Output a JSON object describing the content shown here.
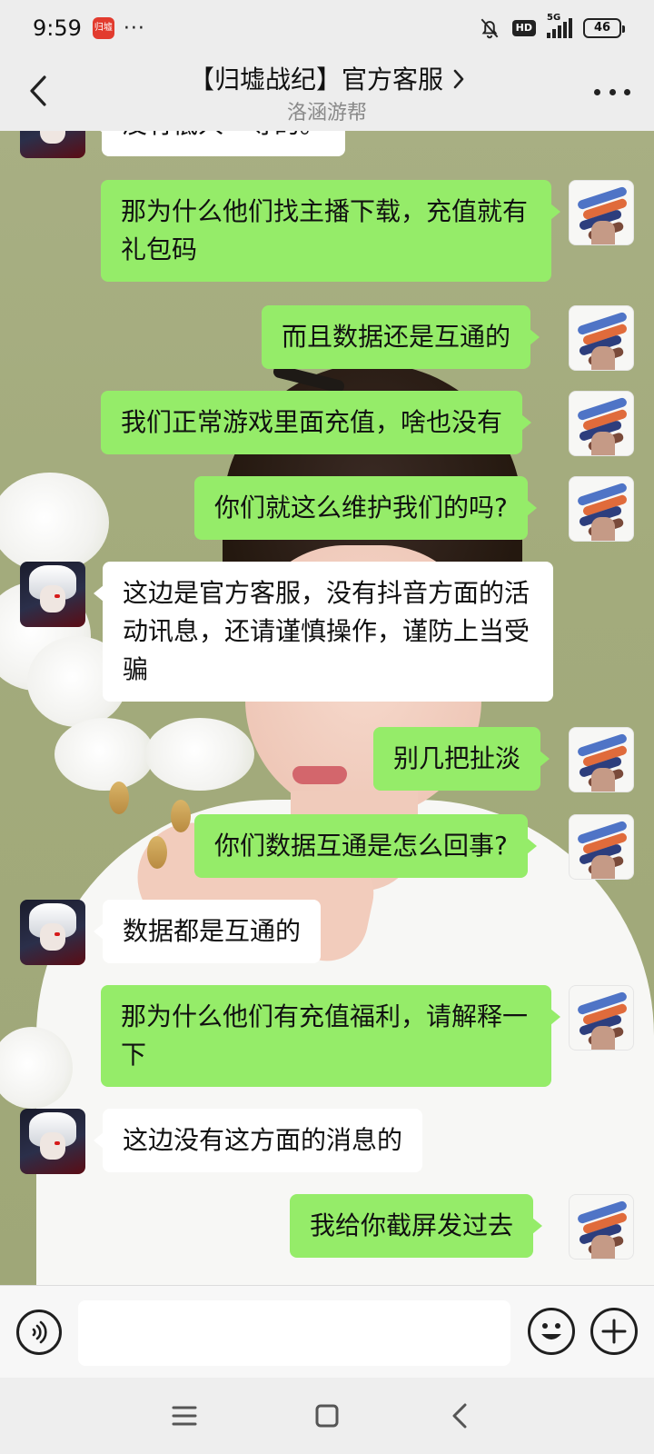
{
  "status_bar": {
    "time": "9:59",
    "app_icon_text": "归墟",
    "overflow": "···",
    "hd": "HD",
    "network": "5G",
    "battery": "46"
  },
  "header": {
    "title": "【归墟战纪】官方客服",
    "subtitle": "洛涵游帮"
  },
  "messages": [
    {
      "from": "them",
      "text": "没有低人一等的。"
    },
    {
      "from": "me",
      "text": "那为什么他们找主播下载，充值就有礼包码"
    },
    {
      "from": "me",
      "text": "而且数据还是互通的"
    },
    {
      "from": "me",
      "text": "我们正常游戏里面充值，啥也没有"
    },
    {
      "from": "me",
      "text": "你们就这么维护我们的吗?"
    },
    {
      "from": "them",
      "text": "这边是官方客服，没有抖音方面的活动讯息，还请谨慎操作，谨防上当受骗"
    },
    {
      "from": "me",
      "text": "别几把扯淡"
    },
    {
      "from": "me",
      "text": "你们数据互通是怎么回事?"
    },
    {
      "from": "them",
      "text": "数据都是互通的"
    },
    {
      "from": "me",
      "text": "那为什么他们有充值福利，请解释一下"
    },
    {
      "from": "them",
      "text": "这边没有这方面的消息的"
    },
    {
      "from": "me",
      "text": "我给你截屏发过去"
    }
  ],
  "input": {
    "value": "",
    "placeholder": ""
  },
  "colors": {
    "my_bubble": "#95ec69",
    "their_bubble": "#ffffff",
    "bar_background": "#ededed"
  },
  "icons": {
    "back": "back-arrow-icon",
    "more": "more-dots-icon",
    "voice": "voice-icon",
    "emoji": "emoji-icon",
    "plus": "plus-icon",
    "nav_menu": "menu-icon",
    "nav_home": "home-icon",
    "nav_back": "nav-back-icon"
  }
}
